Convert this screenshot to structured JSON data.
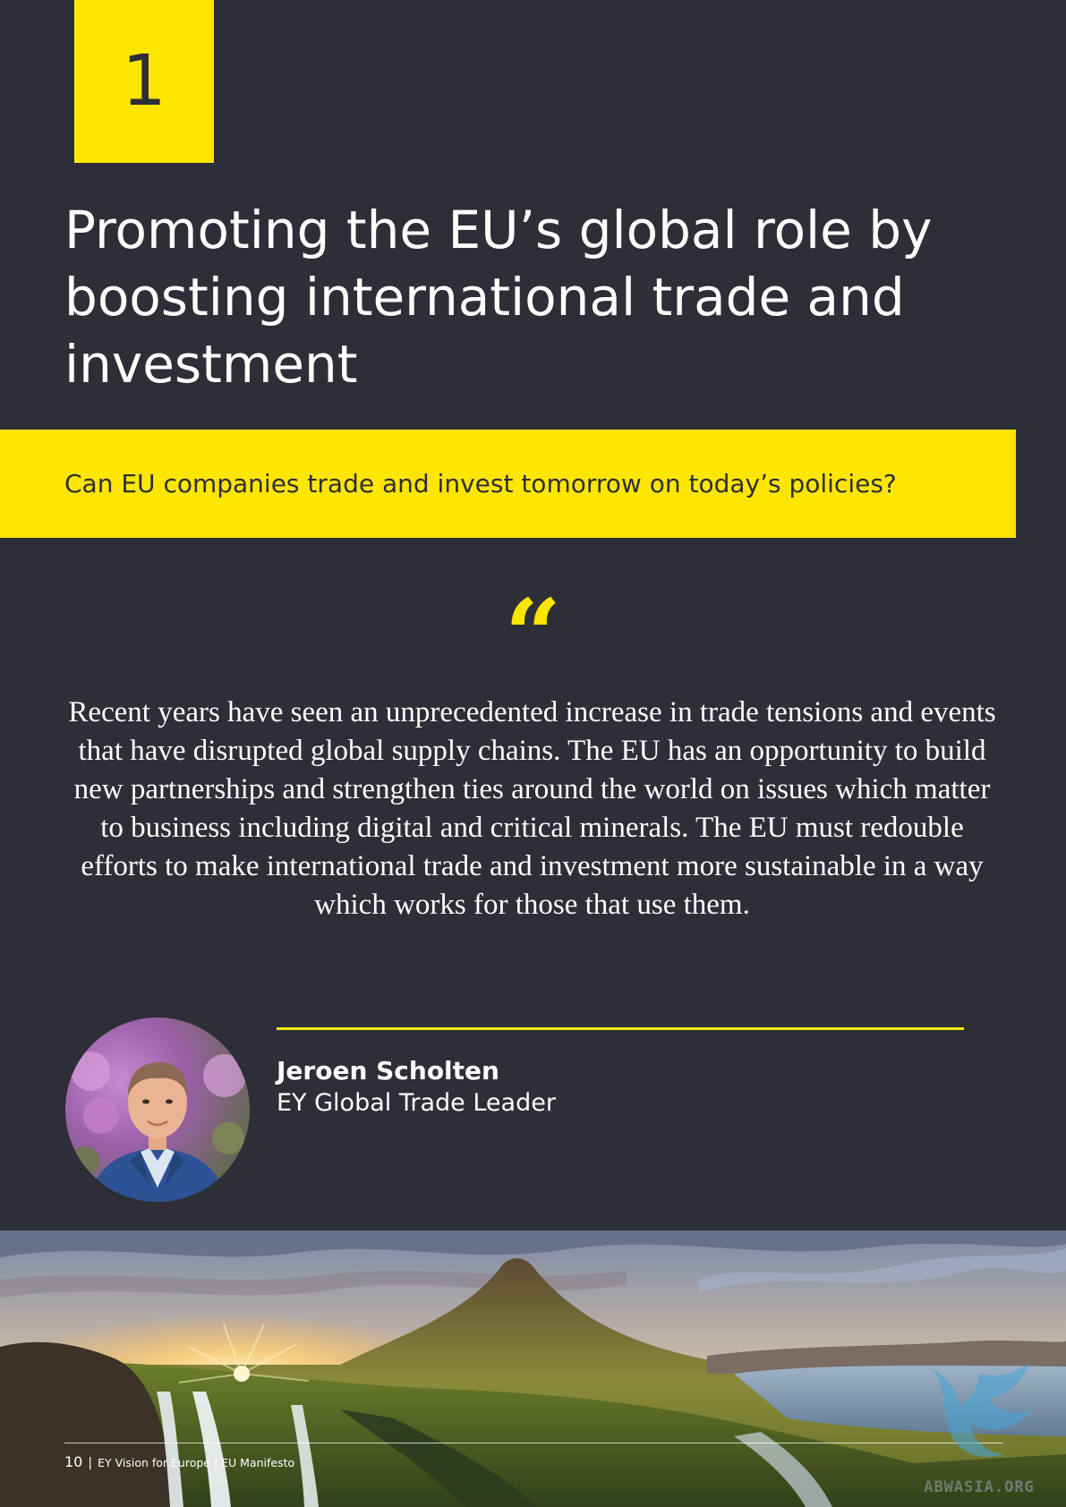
{
  "section": {
    "number": "1",
    "title": "Promoting the EU’s global role by boosting international trade and investment",
    "question": "Can EU companies trade and invest tomorrow on today’s policies?"
  },
  "quote": {
    "mark": "“",
    "text": "Recent years have seen an unprecedented increase in trade tensions and events that have disrupted global supply chains. The EU has an opportunity to build new partnerships and strengthen ties around the world on issues which matter to business including digital and critical minerals. The EU must redouble efforts to make international trade and investment more sustainable in a way which works for those that use them."
  },
  "author": {
    "name": "Jeroen Scholten",
    "role": "EY Global Trade Leader"
  },
  "footer": {
    "page_number": "10",
    "separator": "|",
    "publication": "EY Vision for Europe | EU Manifesto"
  },
  "watermark": {
    "text": "ABWASIA.ORG"
  },
  "colors": {
    "background": "#2e2e38",
    "accent_yellow": "#ffe600",
    "text_white": "#ffffff"
  }
}
